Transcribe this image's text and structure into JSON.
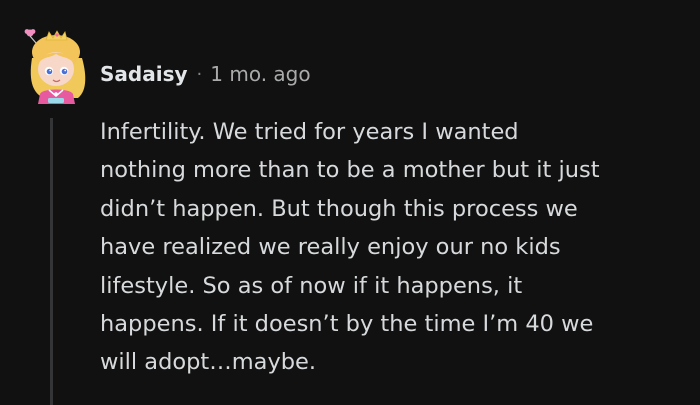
{
  "comment": {
    "username": "Sadaisy",
    "separator": "·",
    "timestamp": "1 mo. ago",
    "avatar_icon": "cartoon-girl-avatar-icon",
    "body_lines": [
      "Infertility. We tried for years I wanted",
      "nothing more than to be a mother but it just",
      "didn’t happen. But though this process we",
      "have realized we really enjoy our no kids",
      "lifestyle. So as of now if it happens, it",
      "happens. If it doesn’t by the time I’m 40 we",
      "will adopt…maybe."
    ]
  },
  "colors": {
    "background": "#111111",
    "text": "#d7dadc",
    "meta": "#a8aaab",
    "thread_line": "#343536"
  }
}
